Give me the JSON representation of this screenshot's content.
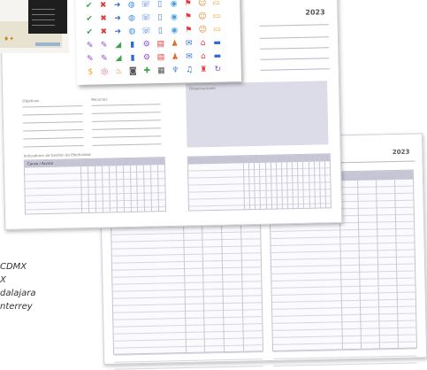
{
  "planner": {
    "year_front": "2023",
    "year_back": "2023",
    "label_middle_left": "Objetivos",
    "label_middle_right": "Recursos",
    "label_notes": "Observaciones",
    "label_table": "Indicadores de Gestión de Efectividad",
    "label_table_head": "Causa / Acción"
  },
  "stickers": {
    "rows": [
      [
        "check-icon",
        "x-icon",
        "arrow-icon",
        "globe-icon",
        "phone-icon",
        "tablet-icon",
        "chat-icon",
        "flag-icon",
        "smile-icon",
        "folder-icon"
      ],
      [
        "check-icon",
        "x-icon",
        "arrow-icon",
        "globe-icon",
        "phone-icon",
        "tablet-icon",
        "chat-icon",
        "flag-icon",
        "smile-icon",
        "folder-icon"
      ],
      [
        "check-icon",
        "x-icon",
        "arrow-icon",
        "globe-icon",
        "phone-icon",
        "tablet-icon",
        "chat-icon",
        "flag-icon",
        "smile-icon",
        "folder-icon"
      ],
      [
        "pen-icon",
        "pen-icon",
        "chart-icon",
        "bar-icon",
        "gear-icon",
        "book-icon",
        "person-icon",
        "mail-icon",
        "home-icon",
        "car-icon"
      ],
      [
        "pen-icon",
        "pen-icon",
        "chart-icon",
        "bar-icon",
        "gear-icon",
        "book-icon",
        "person-icon",
        "mail-icon",
        "home-icon",
        "car-icon"
      ],
      [
        "dollar-icon",
        "coin-icon",
        "food-icon",
        "camera-icon",
        "pill-icon",
        "film-icon",
        "drink-icon",
        "music-icon",
        "bag-icon",
        "sync-icon"
      ]
    ],
    "colors": {
      "check-icon": "#3aa648",
      "x-icon": "#e03a3a",
      "arrow-icon": "#2f6bd6",
      "globe-icon": "#3d8fe0",
      "phone-icon": "#2f6bd6",
      "tablet-icon": "#3a78d8",
      "chat-icon": "#45a0e6",
      "flag-icon": "#e03a3a",
      "smile-icon": "#e08a2a",
      "folder-icon": "#f0a020",
      "pen-icon": "#8a4cc8",
      "chart-icon": "#3aa648",
      "bar-icon": "#2f6bd6",
      "gear-icon": "#8a4cc8",
      "book-icon": "#e03a3a",
      "person-icon": "#e06a2a",
      "mail-icon": "#2f6bd6",
      "home-icon": "#e03a3a",
      "car-icon": "#2f6bd6",
      "dollar-icon": "#f0a020",
      "coin-icon": "#e05a8a",
      "food-icon": "#e06a2a",
      "camera-icon": "#555555",
      "pill-icon": "#3aa648",
      "film-icon": "#555555",
      "drink-icon": "#3d8fe0",
      "music-icon": "#2f6bd6",
      "bag-icon": "#e03a3a",
      "sync-icon": "#8a4cc8"
    },
    "glyphs": {
      "check-icon": "✔",
      "x-icon": "✖",
      "arrow-icon": "➜",
      "globe-icon": "◍",
      "phone-icon": "☏",
      "tablet-icon": "▯",
      "chat-icon": "◉",
      "flag-icon": "⚑",
      "smile-icon": "☺",
      "folder-icon": "▭",
      "pen-icon": "✎",
      "chart-icon": "◢",
      "bar-icon": "▮",
      "gear-icon": "⚙",
      "book-icon": "▤",
      "person-icon": "♟",
      "mail-icon": "✉",
      "home-icon": "⌂",
      "car-icon": "▬",
      "dollar-icon": "$",
      "coin-icon": "◎",
      "food-icon": "♨",
      "camera-icon": "◙",
      "pill-icon": "✚",
      "film-icon": "▦",
      "drink-icon": "♆",
      "music-icon": "♫",
      "bag-icon": "♜",
      "sync-icon": "↻"
    }
  },
  "cities": [
    "CDMX",
    "X",
    "dalajara",
    "nterrey"
  ]
}
